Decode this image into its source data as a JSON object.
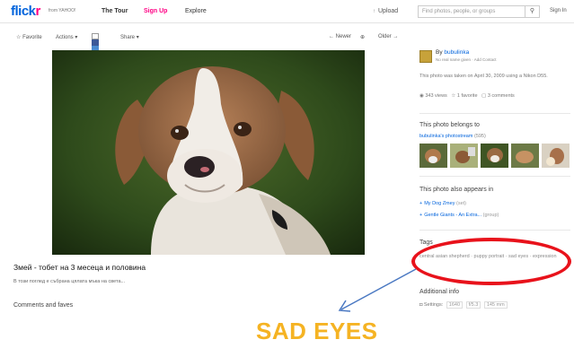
{
  "nav": {
    "logo_text_blue": "flick",
    "logo_text_pink": "r",
    "tagline": "from YAHOO!",
    "tour": "The Tour",
    "signup": "Sign Up",
    "explore": "Explore",
    "upload": "Upload",
    "search_placeholder": "Find photos, people, or groups",
    "search_icon": "magnifier-icon",
    "signin": "Sign In"
  },
  "actions": {
    "favorite": "Favorite",
    "actions": "Actions",
    "share": "Share",
    "newer": "Newer",
    "older": "Older"
  },
  "photo": {
    "title": "Змей - тобет на 3 месеца и половина",
    "description": "В този поглед е събрана цялата мъка на света...",
    "comments_heading": "Comments and faves"
  },
  "sidebar": {
    "owner_by": "By",
    "owner_name": "bubulinka",
    "owner_sub": "No real name given",
    "add_contact": "Add Contact",
    "taken": "This photo was taken on April 30, 2009 using a Nikon D55.",
    "views": "343 views",
    "favorites": "1 favorite",
    "comments": "3 comments",
    "belongs_heading": "This photo belongs to",
    "photostream": "bubulinka's photostream",
    "photostream_count": "(595)",
    "appears_heading": "This photo also appears in",
    "sets": [
      {
        "label": "My Dog Zmey",
        "meta": "(set)"
      },
      {
        "label": "Gentle Giants - An Extra...",
        "meta": "(group)"
      }
    ],
    "tags_heading": "Tags",
    "tags": "central asian shepherd  ·  puppy portrait  ·  sad eyes  ·  expression",
    "additional_heading": "Additional info",
    "settings_label": "Settings:",
    "settings_values": [
      "1640",
      "f/5.3",
      "145 mm"
    ]
  },
  "annotation": {
    "text": "SAD EYES",
    "color": "#f5b323",
    "ellipse_color": "#e8121b",
    "arrow_color": "#4a78c2"
  }
}
